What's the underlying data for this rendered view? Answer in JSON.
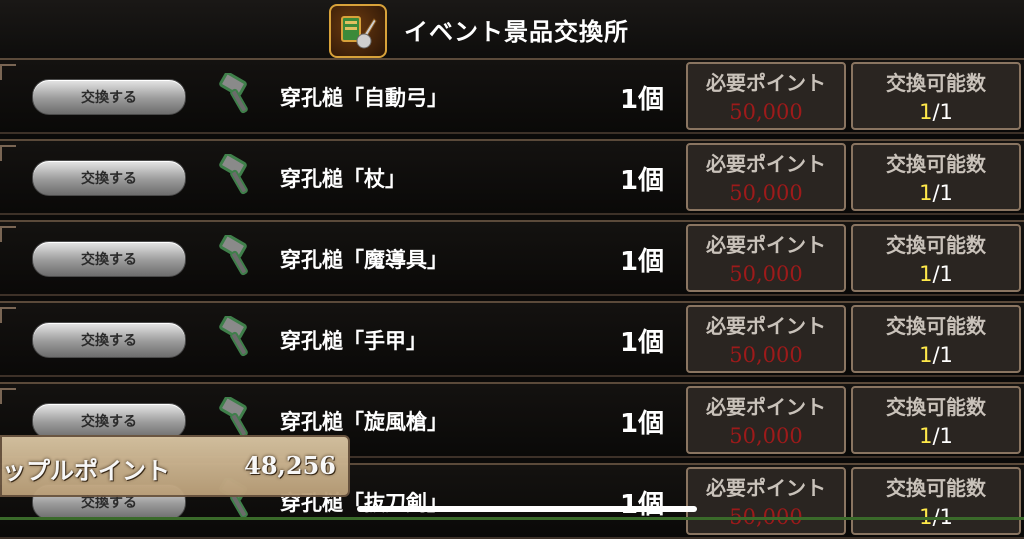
{
  "header": {
    "title": "イベント景品交換所",
    "icon": "event-shop-icon"
  },
  "labels": {
    "exchange_button": "交換する",
    "required_points": "必要ポイント",
    "exchangeable_count": "交換可能数"
  },
  "items": [
    {
      "name": "穿孔槌「自動弓」",
      "quantity": "1個",
      "points": "50,000",
      "count_current": "1",
      "count_total": "/1"
    },
    {
      "name": "穿孔槌「杖」",
      "quantity": "1個",
      "points": "50,000",
      "count_current": "1",
      "count_total": "/1"
    },
    {
      "name": "穿孔槌「魔導具」",
      "quantity": "1個",
      "points": "50,000",
      "count_current": "1",
      "count_total": "/1"
    },
    {
      "name": "穿孔槌「手甲」",
      "quantity": "1個",
      "points": "50,000",
      "count_current": "1",
      "count_total": "/1"
    },
    {
      "name": "穿孔槌「旋風槍」",
      "quantity": "1個",
      "points": "50,000",
      "count_current": "1",
      "count_total": "/1"
    },
    {
      "name": "穿孔槌「抜刀剣」",
      "quantity": "1個",
      "points": "50,000",
      "count_current": "1",
      "count_total": "/1"
    }
  ],
  "points_bar": {
    "label": "ップルポイント",
    "value": "48,256"
  },
  "colors": {
    "required_points": "#9e1a1a",
    "count_current": "#ffe94a",
    "frame": "#8a7561"
  }
}
